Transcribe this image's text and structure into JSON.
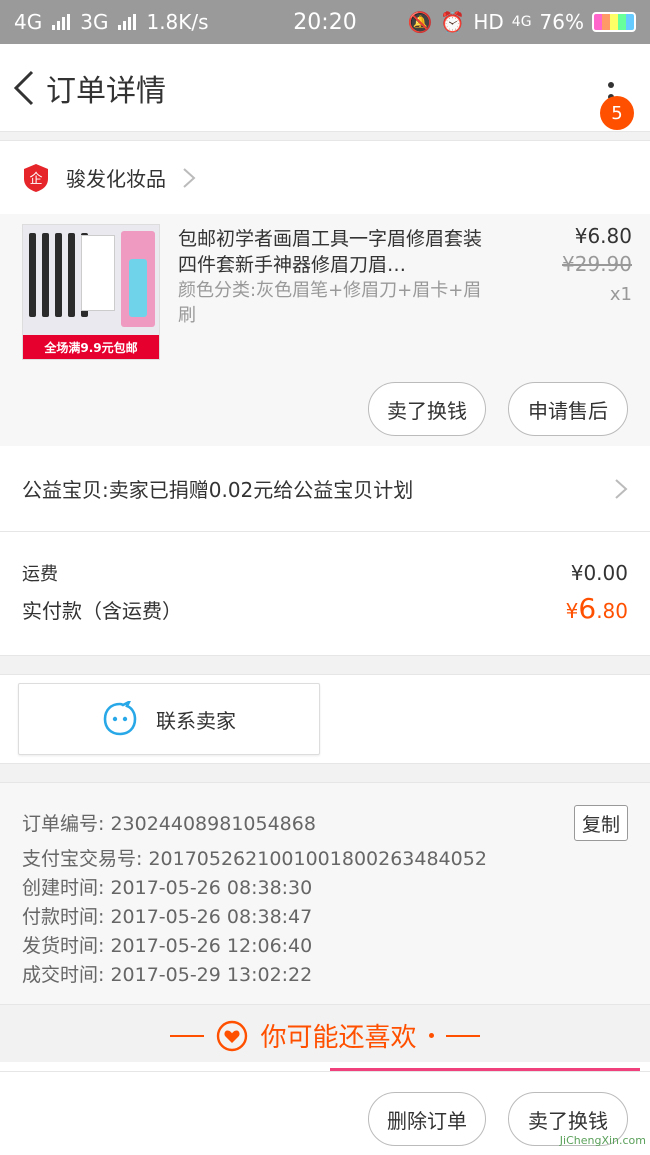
{
  "status_bar": {
    "network1": "4G",
    "network2": "3G",
    "speed": "1.8K/s",
    "time": "20:20",
    "hd": "HD",
    "hd_net": "4G",
    "battery": "76%"
  },
  "nav": {
    "title": "订单详情",
    "badge_count": "5"
  },
  "shop": {
    "name": "骏发化妆品"
  },
  "item": {
    "thumb_banner": "全场满9.9元包邮",
    "title": "包邮初学者画眉工具一字眉修眉套装四件套新手神器修眉刀眉…",
    "sku": "颜色分类:灰色眉笔+修眉刀+眉卡+眉刷",
    "price": "¥6.80",
    "original_price": "¥29.90",
    "quantity": "x1",
    "btn_sell": "卖了换钱",
    "btn_after_sale": "申请售后"
  },
  "charity": {
    "text": "公益宝贝:卖家已捐赠0.02元给公益宝贝计划"
  },
  "fee": {
    "shipping_label": "运费",
    "shipping_value": "¥0.00",
    "paid_label": "实付款（含运费）",
    "paid_currency": "¥",
    "paid_int": "6",
    "paid_dec": ".80"
  },
  "contact": {
    "label": "联系卖家"
  },
  "order_info": {
    "order_no": "订单编号: 23024408981054868",
    "copy_label": "复制",
    "alipay_no": "支付宝交易号: 2017052621001001800263484052",
    "created": "创建时间: 2017-05-26 08:38:30",
    "paid": "付款时间: 2017-05-26 08:38:47",
    "shipped": "发货时间: 2017-05-26 12:06:40",
    "completed": "成交时间: 2017-05-29 13:02:22"
  },
  "recommend": {
    "title": "你可能还喜欢"
  },
  "footer": {
    "btn_delete": "删除订单",
    "btn_sell": "卖了换钱"
  },
  "watermark": "JiChengXin.com",
  "colors": {
    "accent": "#ff5000",
    "statusbar": "#9a9a9a"
  }
}
